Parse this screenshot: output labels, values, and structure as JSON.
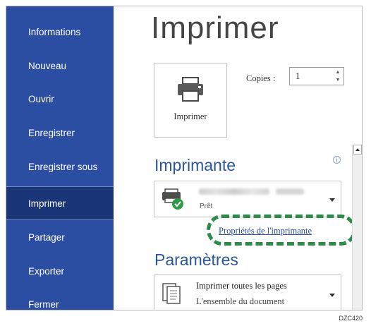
{
  "sidebar": {
    "items": [
      {
        "label": "Informations",
        "active": false
      },
      {
        "label": "Nouveau",
        "active": false
      },
      {
        "label": "Ouvrir",
        "active": false
      },
      {
        "label": "Enregistrer",
        "active": false
      },
      {
        "label": "Enregistrer sous",
        "active": false
      },
      {
        "label": "Imprimer",
        "active": true
      },
      {
        "label": "Partager",
        "active": false
      },
      {
        "label": "Exporter",
        "active": false
      },
      {
        "label": "Fermer",
        "active": false
      }
    ]
  },
  "main": {
    "title": "Imprimer",
    "print_button": {
      "label": "Imprimer",
      "icon": "printer-icon"
    },
    "copies": {
      "label": "Copies :",
      "value": "1"
    },
    "printer_section": {
      "title": "Imprimante",
      "selected_printer_status": "Prêt",
      "properties_link": "Propriétés de l'imprimante"
    },
    "settings_section": {
      "title": "Paramètres",
      "print_range": {
        "title": "Imprimer toutes les pages",
        "subtitle": "L'ensemble du document"
      }
    }
  },
  "colors": {
    "sidebar_bg": "#2b4ea2",
    "sidebar_active_bg": "#1b3678",
    "section_title": "#2b579a",
    "highlight": "#2c8a4a"
  },
  "figure_code": "DZC420"
}
